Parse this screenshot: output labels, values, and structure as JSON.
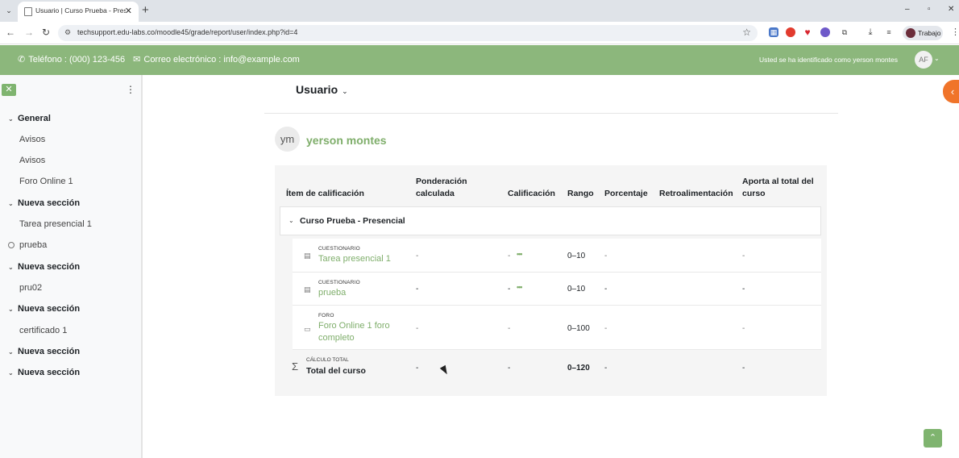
{
  "browser": {
    "tab_title": "Usuario | Curso Prueba - Presencial",
    "tab_close": "✕",
    "new_tab": "+",
    "url": "techsupport.edu-labs.co/moodle45/grade/report/user/index.php?id=4",
    "profile_label": "Trabajo",
    "window_controls": [
      "–",
      "▫",
      "✕"
    ]
  },
  "header": {
    "phone_text": "Teléfono : (000) 123-456",
    "email_text": "Correo electrónico : info@example.com",
    "logged_in_text": "Usted se ha identificado como yerson montes",
    "avatar_initials": "AF",
    "accent_color": "#8cb77c"
  },
  "drawer": {
    "close_icon": "✕",
    "items": [
      {
        "type": "section",
        "label": "General"
      },
      {
        "type": "activity",
        "label": "Avisos"
      },
      {
        "type": "activity",
        "label": "Avisos"
      },
      {
        "type": "activity",
        "label": "Foro Online 1"
      },
      {
        "type": "section",
        "label": "Nueva sección"
      },
      {
        "type": "activity",
        "label": "Tarea presencial 1"
      },
      {
        "type": "circle",
        "label": "prueba"
      },
      {
        "type": "section",
        "label": "Nueva sección"
      },
      {
        "type": "activity",
        "label": "pru02"
      },
      {
        "type": "section",
        "label": "Nueva sección"
      },
      {
        "type": "activity",
        "label": "certificado 1"
      },
      {
        "type": "section",
        "label": "Nueva sección"
      },
      {
        "type": "section",
        "label": "Nueva sección"
      }
    ]
  },
  "main": {
    "page_title": "Usuario",
    "user_initials": "ym",
    "user_name": "yerson montes",
    "columns": {
      "item": "Ítem de calificación",
      "weight": "Ponderación calculada",
      "grade": "Calificación",
      "range": "Rango",
      "percentage": "Porcentaje",
      "feedback": "Retroalimentación",
      "contribution": "Aporta al total del curso"
    },
    "category_name": "Curso Prueba - Presencial",
    "rows": [
      {
        "kind": "CUESTIONARIO",
        "name": "Tarea presencial 1",
        "weight": "-",
        "grade": "-",
        "range": "0–10",
        "percentage": "-",
        "contribution": "-"
      },
      {
        "kind": "CUESTIONARIO",
        "name": "prueba",
        "weight": "-",
        "grade": "-",
        "range": "0–10",
        "percentage": "-",
        "contribution": "-"
      },
      {
        "kind": "FORO",
        "name": "Foro Online 1 foro completo",
        "weight": "-",
        "grade": "-",
        "range": "0–100",
        "percentage": "-",
        "contribution": "-"
      }
    ],
    "total": {
      "kind": "CÁLCULO TOTAL",
      "name": "Total del curso",
      "weight": "-",
      "grade": "-",
      "range": "0–120",
      "percentage": "-",
      "contribution": "-"
    }
  }
}
